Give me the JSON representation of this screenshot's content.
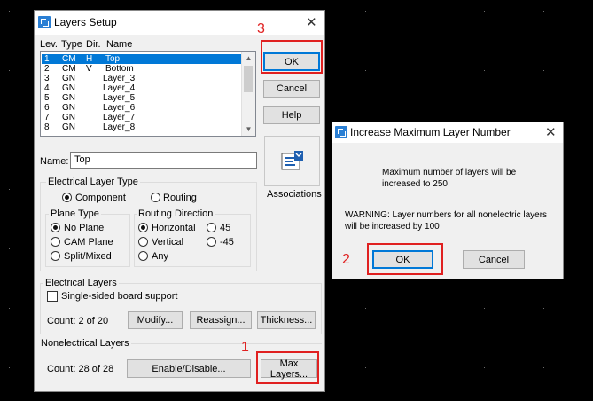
{
  "layers_dialog": {
    "title": "Layers Setup",
    "list_headers": [
      "Lev.",
      "Type",
      "Dir.",
      "Name"
    ],
    "rows": [
      {
        "lev": "1",
        "type": "CM",
        "dir": "H",
        "name": "Top"
      },
      {
        "lev": "2",
        "type": "CM",
        "dir": "V",
        "name": "Bottom"
      },
      {
        "lev": "3",
        "type": "GN",
        "dir": "",
        "name": "Layer_3"
      },
      {
        "lev": "4",
        "type": "GN",
        "dir": "",
        "name": "Layer_4"
      },
      {
        "lev": "5",
        "type": "GN",
        "dir": "",
        "name": "Layer_5"
      },
      {
        "lev": "6",
        "type": "GN",
        "dir": "",
        "name": "Layer_6"
      },
      {
        "lev": "7",
        "type": "GN",
        "dir": "",
        "name": "Layer_7"
      },
      {
        "lev": "8",
        "type": "GN",
        "dir": "",
        "name": "Layer_8"
      }
    ],
    "ok_label": "OK",
    "cancel_label": "Cancel",
    "help_label": "Help",
    "associations_label": "Associations",
    "name_label": "Name:",
    "name_value": "Top",
    "electrical_layer_type": {
      "title": "Electrical  Layer Type",
      "component": "Component",
      "routing": "Routing"
    },
    "plane_type": {
      "title": "Plane Type",
      "no_plane": "No Plane",
      "cam_plane": "CAM Plane",
      "split_mixed": "Split/Mixed"
    },
    "routing_direction": {
      "title": "Routing Direction",
      "horizontal": "Horizontal",
      "deg45": "45",
      "vertical": "Vertical",
      "deg_minus45": "-45",
      "any": "Any"
    },
    "electrical_layers": {
      "title": "Electrical Layers",
      "single_sided": "Single-sided board support",
      "count": "Count:  2 of 20",
      "modify": "Modify...",
      "reassign": "Reassign...",
      "thickness": "Thickness..."
    },
    "nonelectrical_layers": {
      "title": "Nonelectrical Layers",
      "count": "Count:  28 of 28",
      "enable_disable": "Enable/Disable...",
      "max_layers": "Max Layers..."
    }
  },
  "increase_dialog": {
    "title": "Increase Maximum Layer Number",
    "message_line1": "Maximum number of layers will be",
    "message_line2": "increased to 250",
    "warning_line1": "WARNING: Layer numbers for all nonelectric layers",
    "warning_line2": "will be increased by 100",
    "ok_label": "OK",
    "cancel_label": "Cancel"
  },
  "annotations": {
    "step1": "1",
    "step2": "2",
    "step3": "3",
    "highlight_color": "#e02020"
  },
  "icons": {
    "app": "pads-app-icon",
    "close": "close-icon",
    "associations": "associations-icon"
  }
}
